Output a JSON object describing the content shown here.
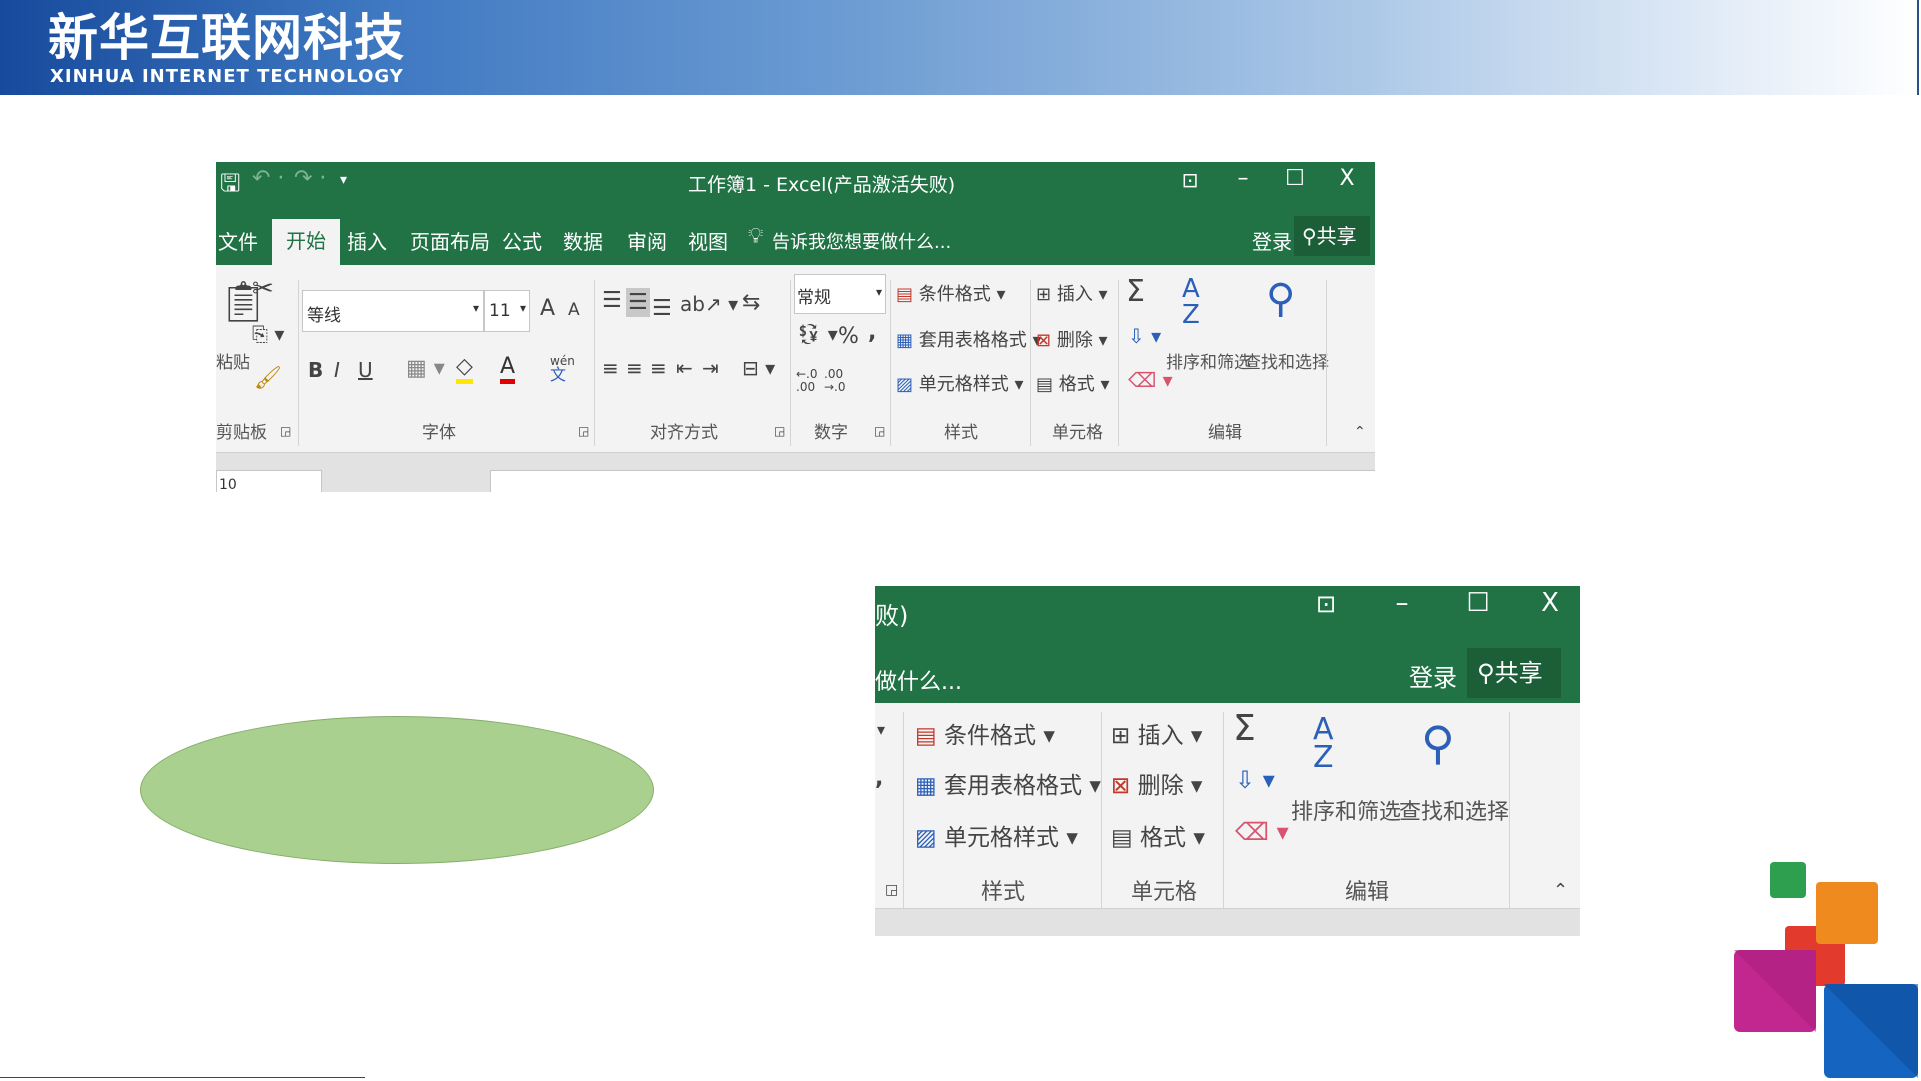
{
  "header": {
    "company_cn": "新华互联网科技",
    "company_en": "XINHUA INTERNET TECHNOLOGY"
  },
  "excel_main": {
    "title": "工作簿1 - Excel(产品激活失败)",
    "ribbon_display_icon": "ribbon-display-options-icon",
    "minimize": "–",
    "maximize": "☐",
    "close": "X",
    "tabs": [
      "文件",
      "开始",
      "插入",
      "页面布局",
      "公式",
      "数据",
      "审阅",
      "视图"
    ],
    "active_tab": "开始",
    "tell_me": "告诉我您想要做什么...",
    "login": "登录",
    "share": "共享",
    "clipboard": {
      "paste": "粘贴",
      "group": "剪贴板"
    },
    "font": {
      "name": "等线",
      "size": "11",
      "bold": "B",
      "italic": "I",
      "underline": "U",
      "grow": "A",
      "shrink": "A",
      "font_color": "A",
      "phonetic_top": "wén",
      "phonetic_bottom": "文",
      "group": "字体"
    },
    "alignment": {
      "group": "对齐方式"
    },
    "number": {
      "format": "常规",
      "percent": "%",
      "comma": ",",
      "inc_dec": "←.0 .00",
      "dec_dec": ".00 →.0",
      "group": "数字"
    },
    "styles": {
      "conditional": "条件格式",
      "table": "套用表格格式",
      "cell": "单元格样式",
      "group": "样式"
    },
    "cells": {
      "insert": "插入",
      "delete": "删除",
      "format": "格式",
      "group": "单元格"
    },
    "editing": {
      "sum": "Σ",
      "sort": "排序和筛选",
      "find": "查找和选择",
      "group": "编辑"
    },
    "name_box": "10"
  },
  "excel_zoom": {
    "title_fragment": "败)",
    "tell_me_fragment": "做什么...",
    "minimize": "–",
    "maximize": "☐",
    "close": "X",
    "login": "登录",
    "share": "共享",
    "styles": {
      "conditional": "条件格式",
      "table": "套用表格格式",
      "cell": "单元格样式",
      "group": "样式"
    },
    "cells": {
      "insert": "插入",
      "delete": "删除",
      "format": "格式",
      "group": "单元格"
    },
    "editing": {
      "sum": "Σ",
      "sort": "排序和筛选",
      "find": "查找和选择",
      "group": "编辑"
    }
  },
  "colors": {
    "excel_green": "#217346",
    "oval_fill": "#a9d08e",
    "banner_blue": "#174a9c",
    "deco_green": "#2e9e4f",
    "deco_orange": "#ef8a1e",
    "deco_red": "#e23b2e",
    "deco_magenta": "#c2278f",
    "deco_blue": "#1565c0"
  }
}
